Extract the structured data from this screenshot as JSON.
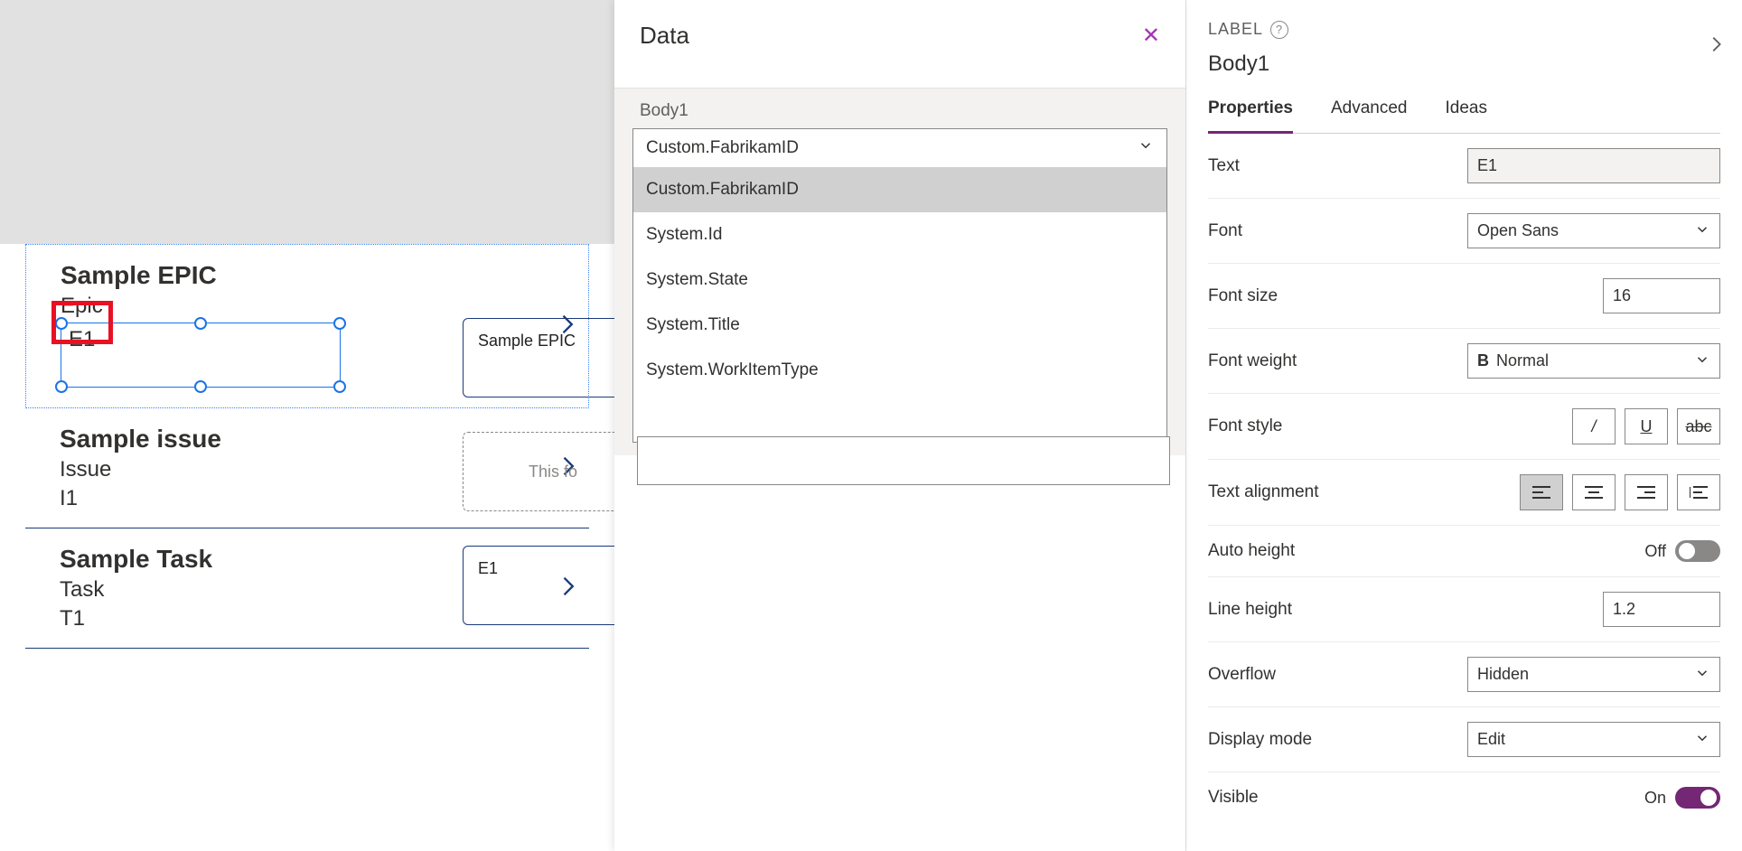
{
  "canvas": {
    "cards": [
      {
        "title": "Sample EPIC",
        "subtitle": "Epic",
        "body": "E1",
        "selected": true
      },
      {
        "title": "Sample issue",
        "subtitle": "Issue",
        "body": "I1",
        "selected": false
      },
      {
        "title": "Sample Task",
        "subtitle": "Task",
        "body": "T1",
        "selected": false
      }
    ]
  },
  "preview": {
    "card1": "Sample EPIC",
    "card2_placeholder": "This fo",
    "card3": "E1"
  },
  "data_panel": {
    "title": "Data",
    "field_label": "Body1",
    "selected_value": "Custom.FabrikamID",
    "options": [
      "Custom.FabrikamID",
      "System.Id",
      "System.State",
      "System.Title",
      "System.WorkItemType"
    ]
  },
  "props_panel": {
    "type_label": "LABEL",
    "control_name": "Body1",
    "tabs": [
      "Properties",
      "Advanced",
      "Ideas"
    ],
    "active_tab": "Properties",
    "properties": {
      "text": {
        "label": "Text",
        "value": "E1"
      },
      "font": {
        "label": "Font",
        "value": "Open Sans"
      },
      "font_size": {
        "label": "Font size",
        "value": "16"
      },
      "font_weight": {
        "label": "Font weight",
        "value": "Normal"
      },
      "font_style": {
        "label": "Font style"
      },
      "text_alignment": {
        "label": "Text alignment"
      },
      "auto_height": {
        "label": "Auto height",
        "value": "Off"
      },
      "line_height": {
        "label": "Line height",
        "value": "1.2"
      },
      "overflow": {
        "label": "Overflow",
        "value": "Hidden"
      },
      "display_mode": {
        "label": "Display mode",
        "value": "Edit"
      },
      "visible": {
        "label": "Visible",
        "value": "On"
      }
    }
  }
}
